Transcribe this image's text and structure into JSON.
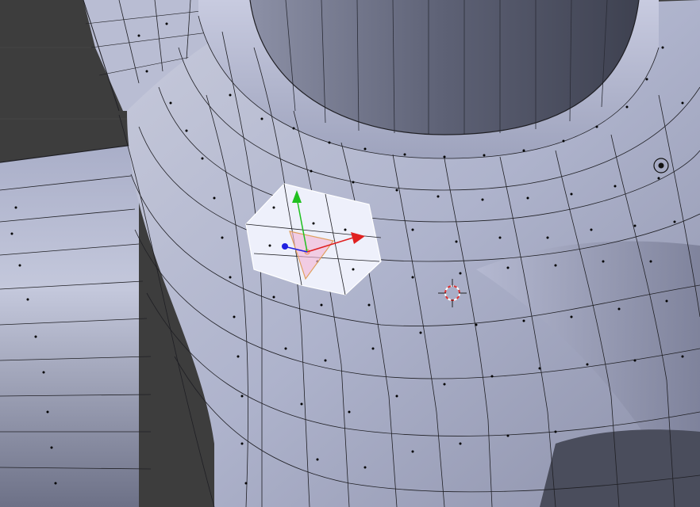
{
  "viewport": {
    "background_color": "#3d3d3d",
    "grid_color": "#5a5a5a",
    "mesh": {
      "shading": "solid",
      "fill_light": "#d9dce8",
      "fill_mid": "#aeb3cc",
      "fill_dark": "#6d7187",
      "wire_color": "#1f1f24",
      "face_dot_color": "#000000",
      "selected_face_color": "#eef0fb",
      "selected_edge_color": "#ffffff"
    },
    "gizmo": {
      "x_axis_color": "#e02020",
      "y_axis_color": "#20c020",
      "z_axis_color": "#2020e0",
      "pivot_fill": "#f4b4d4",
      "pivot_stroke": "#e0a060"
    },
    "cursor_3d": {
      "ring_color_a": "#ffffff",
      "ring_color_b": "#e03030",
      "cross_color": "#222222"
    },
    "empty_marker": {
      "color": "#111111"
    }
  }
}
